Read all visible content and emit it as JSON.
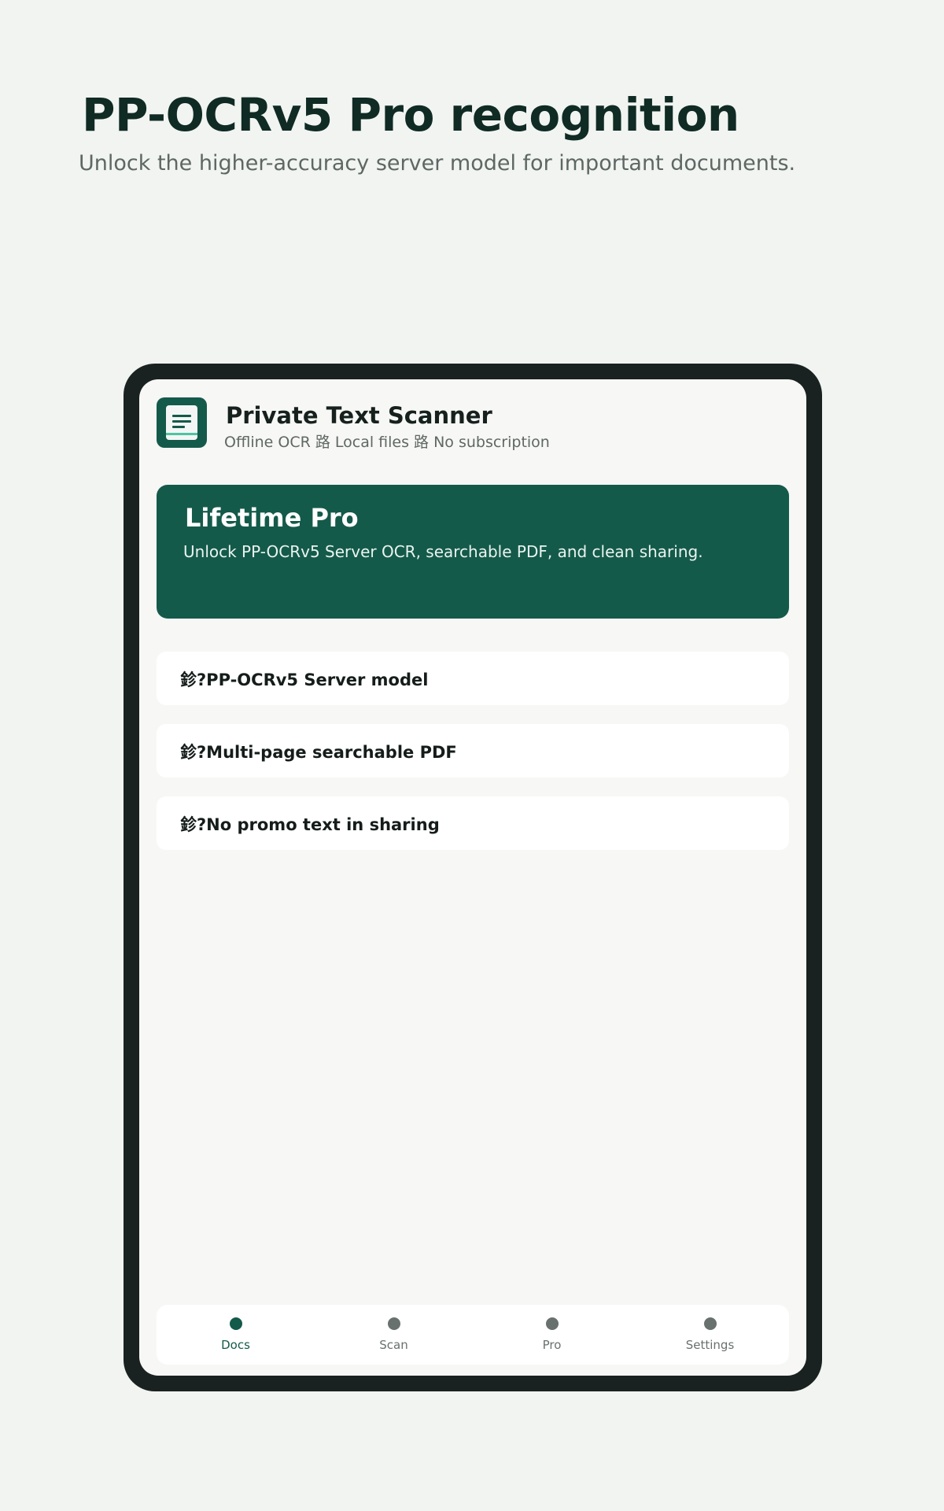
{
  "hero": {
    "title": "PP-OCRv5 Pro recognition",
    "subtitle": "Unlock the higher-accuracy server model for important documents."
  },
  "app": {
    "icon": "document-icon",
    "name": "Private Text Scanner",
    "tagline": "Offline OCR 路 Local files 路 No subscription"
  },
  "pro_card": {
    "title": "Lifetime Pro",
    "description": "Unlock PP-OCRv5 Server OCR, searchable PDF, and clean sharing."
  },
  "features": [
    "鉁?PP-OCRv5 Server model",
    "鉁?Multi-page searchable PDF",
    "鉁?No promo text in sharing"
  ],
  "nav": {
    "active": "Docs",
    "items": [
      "Docs",
      "Scan",
      "Pro",
      "Settings"
    ]
  },
  "colors": {
    "brand": "#145a4a",
    "page_background": "#f1f4f1",
    "device_frame": "#192220",
    "screen_background": "#f7f7f5",
    "inactive": "#68716d"
  }
}
